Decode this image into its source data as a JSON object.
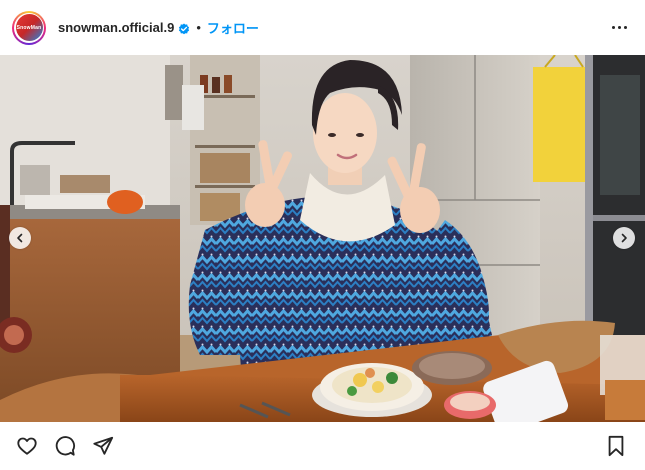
{
  "header": {
    "account_name": "snowman.official.9",
    "separator": "•",
    "follow_label": "フォロー",
    "avatar_text": "SnowMan",
    "verified_icon": "verified-badge-icon",
    "more_icon": "more-options-icon"
  },
  "post": {
    "image_description_icon": "photo-content",
    "prev_icon": "chevron-left-icon",
    "next_icon": "chevron-right-icon"
  },
  "actions": {
    "like_icon": "heart-icon",
    "comment_icon": "comment-icon",
    "share_icon": "send-icon",
    "save_icon": "bookmark-icon"
  },
  "colors": {
    "accent": "#0095f6",
    "text": "#262626",
    "verified": "#0095f6"
  }
}
